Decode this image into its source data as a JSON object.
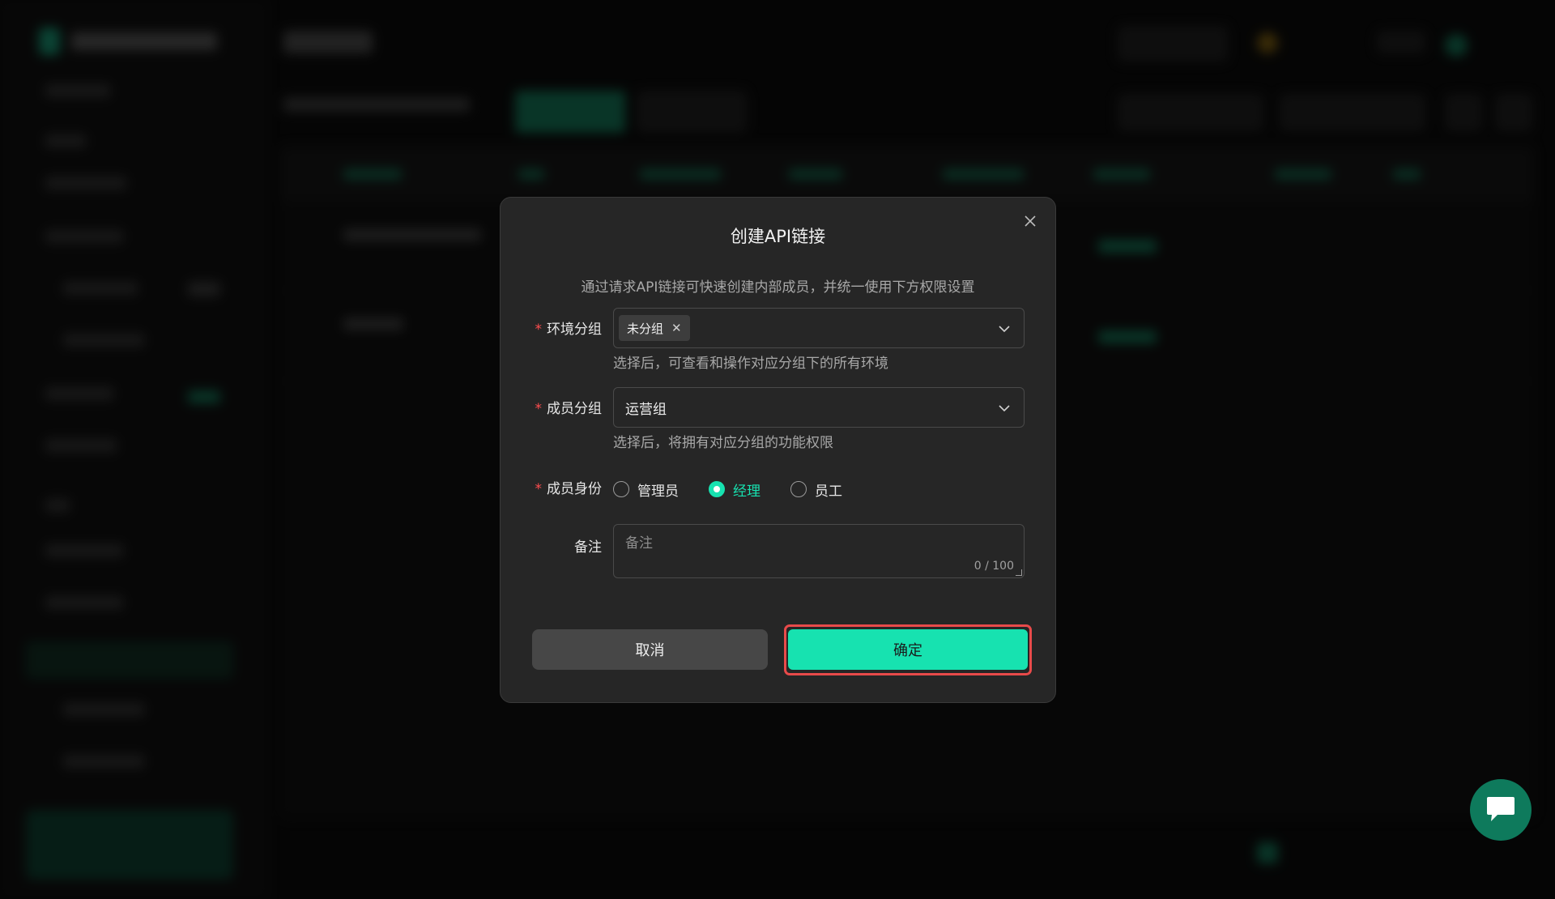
{
  "modal": {
    "title": "创建API链接",
    "description": "通过请求API链接可快速创建内部成员，并统一使用下方权限设置",
    "env_group": {
      "label": "环境分组",
      "tag": "未分组",
      "help": "选择后，可查看和操作对应分组下的所有环境"
    },
    "member_group": {
      "label": "成员分组",
      "value": "运营组",
      "help": "选择后，将拥有对应分组的功能权限"
    },
    "member_role": {
      "label": "成员身份",
      "options": [
        "管理员",
        "经理",
        "员工"
      ],
      "selected": "经理"
    },
    "remark": {
      "label": "备注",
      "placeholder": "备注",
      "counter": "0 / 100"
    },
    "cancel_label": "取消",
    "confirm_label": "确定"
  },
  "colors": {
    "accent": "#17e2b0",
    "required": "#ff4d4f",
    "highlight": "#e84a4a"
  }
}
